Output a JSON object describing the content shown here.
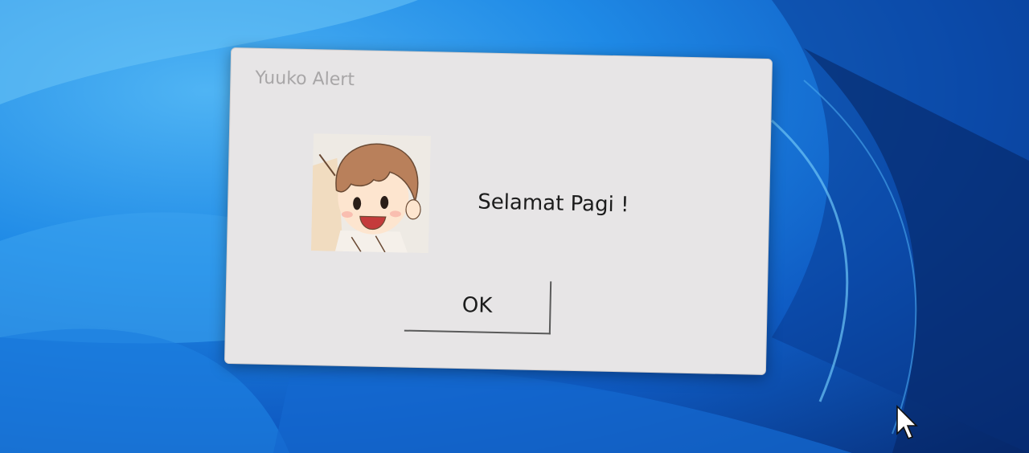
{
  "dialog": {
    "title": "Yuuko Alert",
    "message": "Selamat Pagi !",
    "ok_label": "OK",
    "icon": "yuuko-character-icon"
  },
  "desktop": {
    "wallpaper": "windows-11-bloom",
    "accent": "#1f8ae6"
  }
}
